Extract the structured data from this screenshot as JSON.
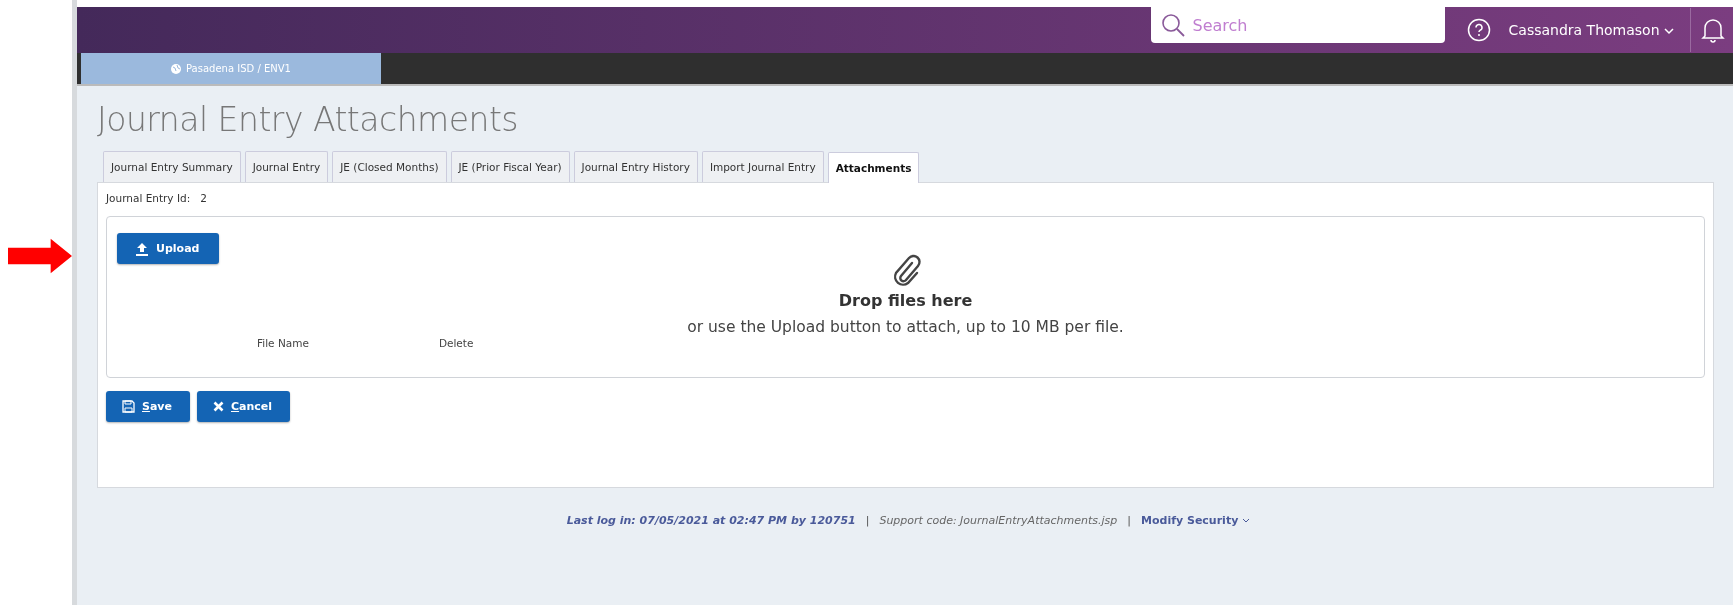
{
  "header": {
    "search": {
      "placeholder": "Search"
    },
    "user": "Cassandra Thomason"
  },
  "environment": "Pasadena ISD / ENV1",
  "page_title": "Journal Entry Attachments",
  "tabs": [
    {
      "label": "Journal Entry Summary",
      "selected": false
    },
    {
      "label": "Journal Entry",
      "selected": false
    },
    {
      "label": "JE (Closed Months)",
      "selected": false
    },
    {
      "label": "JE (Prior Fiscal Year)",
      "selected": false
    },
    {
      "label": "Journal Entry History",
      "selected": false
    },
    {
      "label": "Import Journal Entry",
      "selected": false
    },
    {
      "label": "Attachments",
      "selected": true
    }
  ],
  "entry_id": {
    "label": "Journal Entry Id:",
    "value": "2"
  },
  "dropzone": {
    "upload_button": "Upload",
    "heading": "Drop files here",
    "hint": "or use the Upload button to attach, up to 10 MB per file.",
    "columns": [
      "File Name",
      "Delete"
    ]
  },
  "buttons": [
    {
      "kind": "save",
      "label": "Save"
    },
    {
      "kind": "cancel",
      "label": "Cancel"
    }
  ],
  "footer": {
    "last_login": "Last log in: 07/05/2021 at 02:47 PM by 120751",
    "separator_1": "|",
    "support": "Support code: JournalEntryAttachments.jsp",
    "separator_2": "|",
    "modify": "Modify Security"
  }
}
